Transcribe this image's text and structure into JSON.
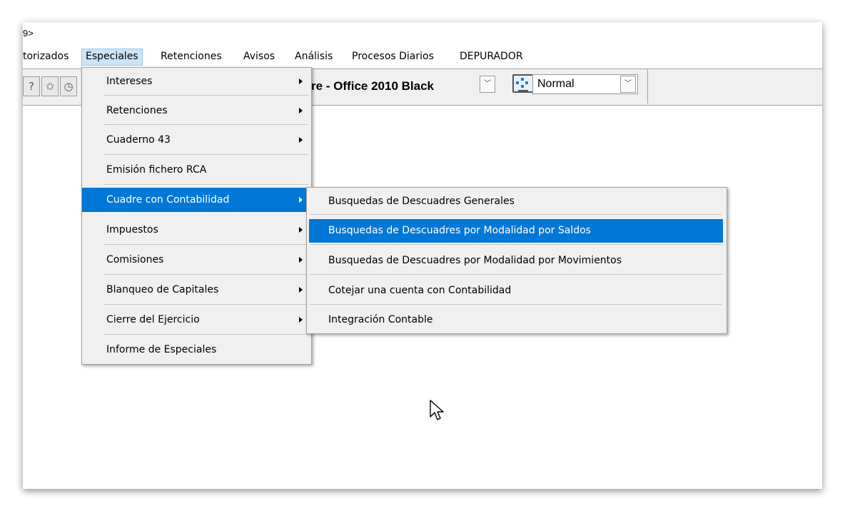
{
  "window": {
    "title_fragment": "9>"
  },
  "menubar": {
    "items": [
      {
        "label": "torizados"
      },
      {
        "label": "Especiales"
      },
      {
        "label": "Retenciones"
      },
      {
        "label": "Avisos"
      },
      {
        "label": "Análisis"
      },
      {
        "label": "Procesos Diarios"
      },
      {
        "label": "DEPURADOR"
      }
    ]
  },
  "toolbar": {
    "skin_combo_value": "re - Office 2010 Black",
    "view_combo_value": "Normal",
    "icons": [
      "help-icon",
      "star-icon",
      "clock-icon",
      "monitor-icon"
    ]
  },
  "especiales_menu": {
    "items": [
      {
        "label": "Intereses",
        "has_submenu": true
      },
      {
        "label": "Retenciones",
        "has_submenu": true
      },
      {
        "label": "Cuaderno 43",
        "has_submenu": true
      },
      {
        "label": "Emisión fichero RCA",
        "has_submenu": false
      },
      {
        "label": "Cuadre con Contabilidad",
        "has_submenu": true,
        "highlighted": true
      },
      {
        "label": "Impuestos",
        "has_submenu": true
      },
      {
        "label": "Comisiones",
        "has_submenu": true
      },
      {
        "label": "Blanqueo de Capitales",
        "has_submenu": true
      },
      {
        "label": "Cierre del Ejercicio",
        "has_submenu": true
      },
      {
        "label": "Informe de Especiales",
        "has_submenu": false
      }
    ]
  },
  "cuadre_submenu": {
    "items": [
      {
        "label": "Busquedas de Descuadres Generales"
      },
      {
        "label": "Busquedas de Descuadres por Modalidad por Saldos",
        "highlighted": true
      },
      {
        "label": "Busquedas de Descuadres por Modalidad por Movimientos"
      },
      {
        "label": "Cotejar una cuenta con Contabilidad"
      },
      {
        "label": "Integración Contable"
      }
    ]
  },
  "colors": {
    "highlight": "#0078d7",
    "menu_bg": "#f0f0f0",
    "active_menubar_bg": "#cce4f7"
  }
}
